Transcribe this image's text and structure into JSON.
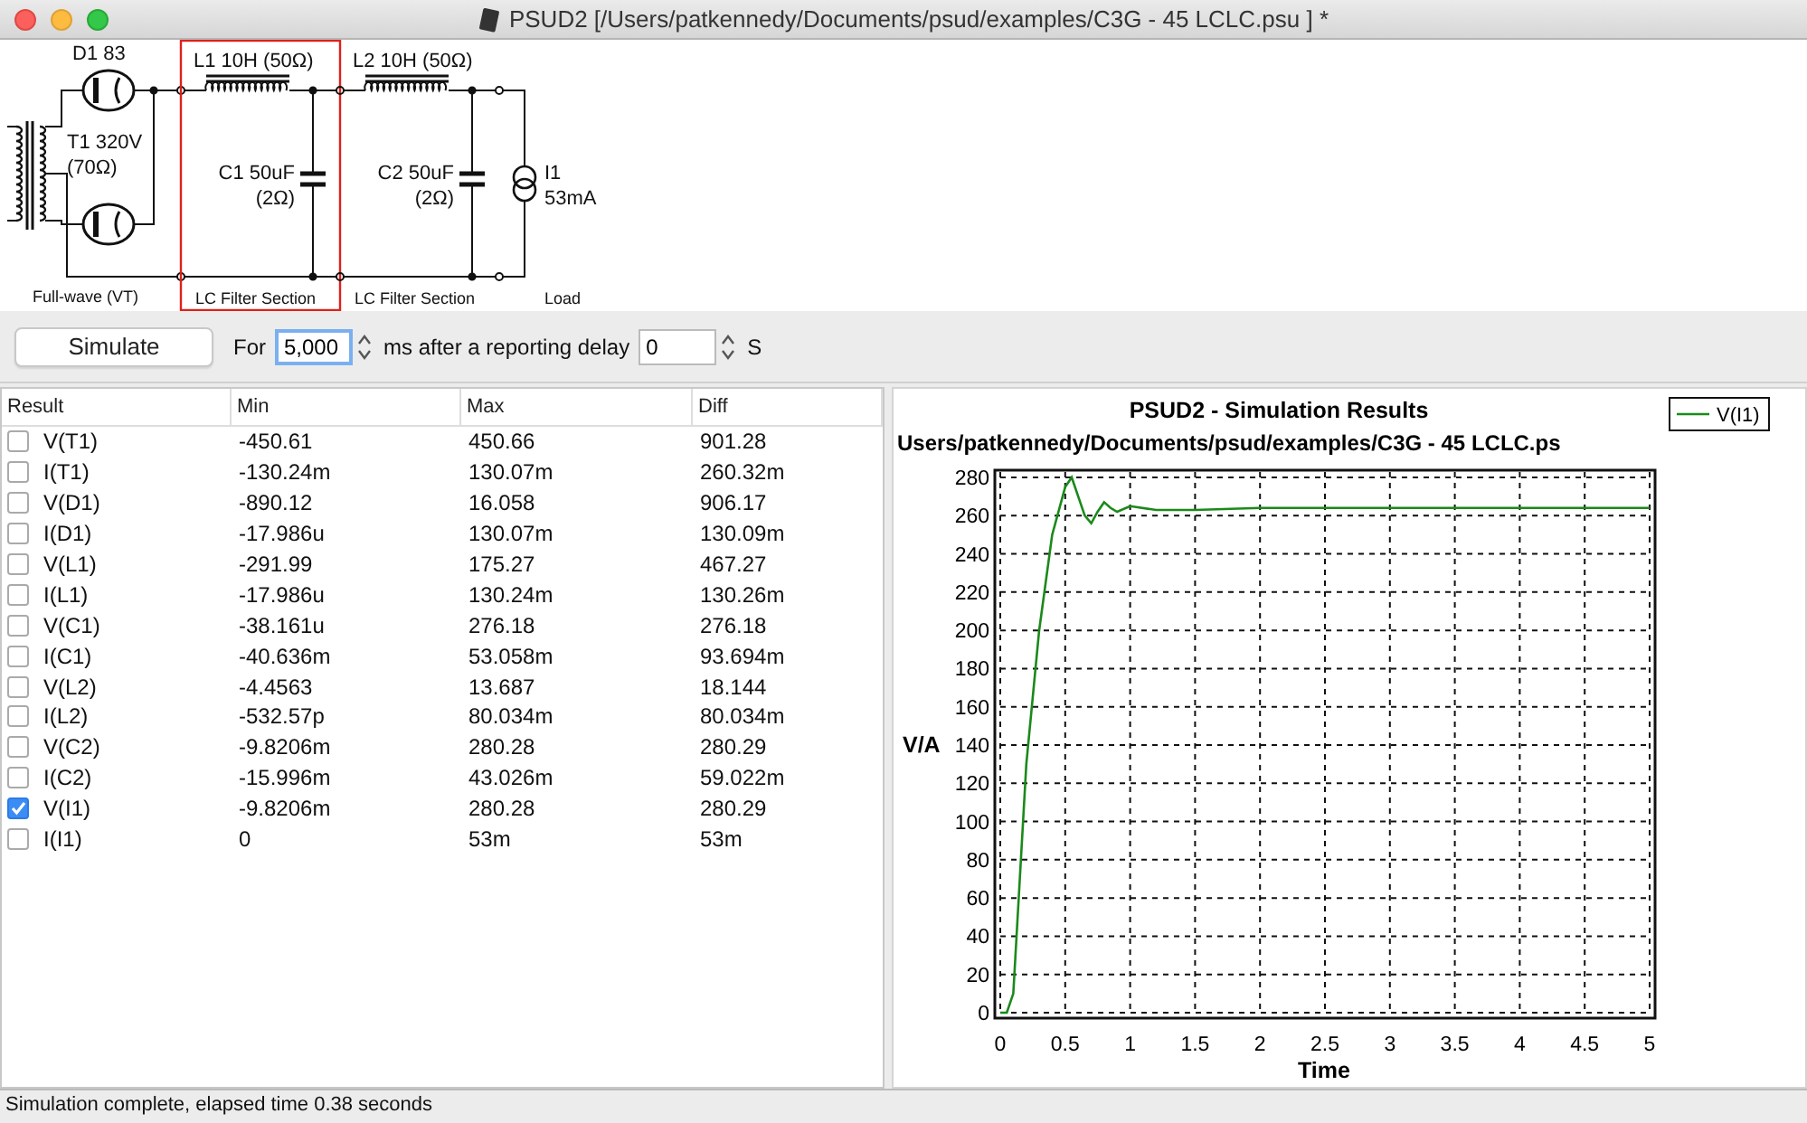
{
  "window": {
    "title": "PSUD2  [/Users/patkennedy/Documents/psud/examples/C3G - 45 LCLC.psu ] *"
  },
  "schematic": {
    "sections": [
      {
        "kind": "rectifier",
        "label": "Full-wave (VT)",
        "selected": false,
        "texts": [
          "D1 83",
          "T1 320V",
          "(70Ω)"
        ]
      },
      {
        "kind": "lc",
        "label": "LC Filter Section",
        "selected": true,
        "texts": [
          "L1 10H (50Ω)",
          "C1 50uF",
          "(2Ω)"
        ]
      },
      {
        "kind": "lc",
        "label": "LC Filter Section",
        "selected": false,
        "texts": [
          "L2 10H (50Ω)",
          "C2 50uF",
          "(2Ω)"
        ]
      },
      {
        "kind": "load",
        "label": "Load",
        "selected": false,
        "texts": [
          "I1",
          "53mA"
        ]
      }
    ]
  },
  "controls": {
    "simulate_button": "Simulate",
    "for_label": "For",
    "duration": {
      "value": "5,000",
      "focused": true
    },
    "duration_units": "ms after a reporting delay",
    "delay": {
      "value": "0",
      "focused": false
    },
    "delay_units": "S"
  },
  "results_table": {
    "columns": [
      "Result",
      "Min",
      "Max",
      "Diff"
    ],
    "rows": [
      {
        "checked": false,
        "cells": [
          "V(T1)",
          "-450.61",
          "450.66",
          "901.28"
        ]
      },
      {
        "checked": false,
        "cells": [
          "I(T1)",
          "-130.24m",
          "130.07m",
          "260.32m"
        ]
      },
      {
        "checked": false,
        "cells": [
          "V(D1)",
          "-890.12",
          "16.058",
          "906.17"
        ]
      },
      {
        "checked": false,
        "cells": [
          "I(D1)",
          "-17.986u",
          "130.07m",
          "130.09m"
        ]
      },
      {
        "checked": false,
        "cells": [
          "V(L1)",
          "-291.99",
          "175.27",
          "467.27"
        ]
      },
      {
        "checked": false,
        "cells": [
          "I(L1)",
          "-17.986u",
          "130.24m",
          "130.26m"
        ]
      },
      {
        "checked": false,
        "cells": [
          "V(C1)",
          "-38.161u",
          "276.18",
          "276.18"
        ]
      },
      {
        "checked": false,
        "cells": [
          "I(C1)",
          "-40.636m",
          "53.058m",
          "93.694m"
        ]
      },
      {
        "checked": false,
        "cells": [
          "V(L2)",
          "-4.4563",
          "13.687",
          "18.144"
        ]
      },
      {
        "checked": false,
        "cells": [
          "I(L2)",
          "-532.57p",
          "80.034m",
          "80.034m"
        ]
      },
      {
        "checked": false,
        "cells": [
          "V(C2)",
          "-9.8206m",
          "280.28",
          "280.29"
        ]
      },
      {
        "checked": false,
        "cells": [
          "I(C2)",
          "-15.996m",
          "43.026m",
          "59.022m"
        ]
      },
      {
        "checked": true,
        "cells": [
          "V(I1)",
          "-9.8206m",
          "280.28",
          "280.29"
        ]
      },
      {
        "checked": false,
        "cells": [
          "I(I1)",
          "0",
          "53m",
          "53m"
        ]
      }
    ]
  },
  "chart": {
    "subtitle": "Users/patkennedy/Documents/psud/examples/C3G - 45 LCLC.ps",
    "chart_data": {
      "type": "line",
      "title": "PSUD2 - Simulation Results",
      "xlabel": "Time",
      "ylabel": "V/A",
      "x": [
        0,
        0.05,
        0.1,
        0.15,
        0.2,
        0.3,
        0.4,
        0.5,
        0.55,
        0.6,
        0.65,
        0.7,
        0.75,
        0.8,
        0.85,
        0.9,
        1,
        1.2,
        1.5,
        2,
        3,
        4,
        5
      ],
      "series": [
        {
          "name": "V(I1)",
          "color": "#1a8a1a",
          "values": [
            0,
            0,
            10,
            70,
            130,
            200,
            250,
            275,
            280,
            270,
            260,
            256,
            262,
            267,
            264,
            262,
            265,
            263,
            263,
            264,
            264,
            264,
            264
          ]
        }
      ],
      "grid": true,
      "xlim": [
        0,
        5
      ],
      "ylim": [
        0,
        280
      ],
      "xticks": [
        0,
        0.5,
        1,
        1.5,
        2,
        2.5,
        3,
        3.5,
        4,
        4.5,
        5
      ],
      "yticks": [
        0,
        20,
        40,
        60,
        80,
        100,
        120,
        140,
        160,
        180,
        200,
        220,
        240,
        260,
        280
      ]
    }
  },
  "status_bar": "Simulation complete, elapsed time 0.38 seconds"
}
